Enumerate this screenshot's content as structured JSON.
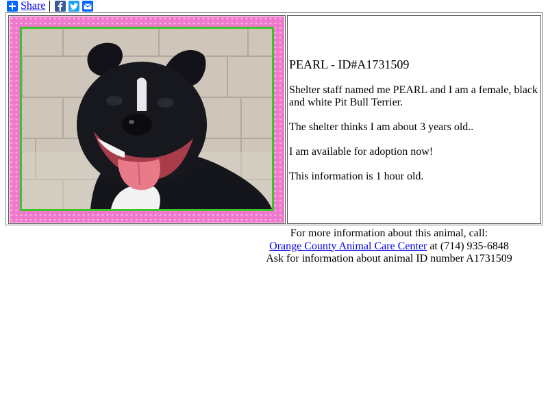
{
  "share": {
    "label": "Share",
    "icons": [
      "plus-icon",
      "facebook-icon",
      "twitter-icon",
      "email-icon"
    ],
    "icon_glyphs": {
      "plus": "+",
      "facebook": "f",
      "twitter": "t",
      "email": "✉"
    }
  },
  "animal": {
    "title": "PEARL - ID#A1731509",
    "description": "Shelter staff named me PEARL and I am a female, black and white Pit Bull Terrier.",
    "age": "The shelter thinks I am about 3 years old..",
    "availability": "I am available for adoption now!",
    "freshness": "This information is 1 hour old."
  },
  "contact": {
    "intro": "For more information about this animal, call:",
    "shelter_link": "Orange County Animal Care Center",
    "phone": " at (714) 935-6848",
    "ask": "Ask for information about animal ID number A1731509"
  },
  "colors": {
    "link": "#0000ee",
    "frame_pink": "#ef77cc",
    "frame_green": "#3cc42a"
  }
}
